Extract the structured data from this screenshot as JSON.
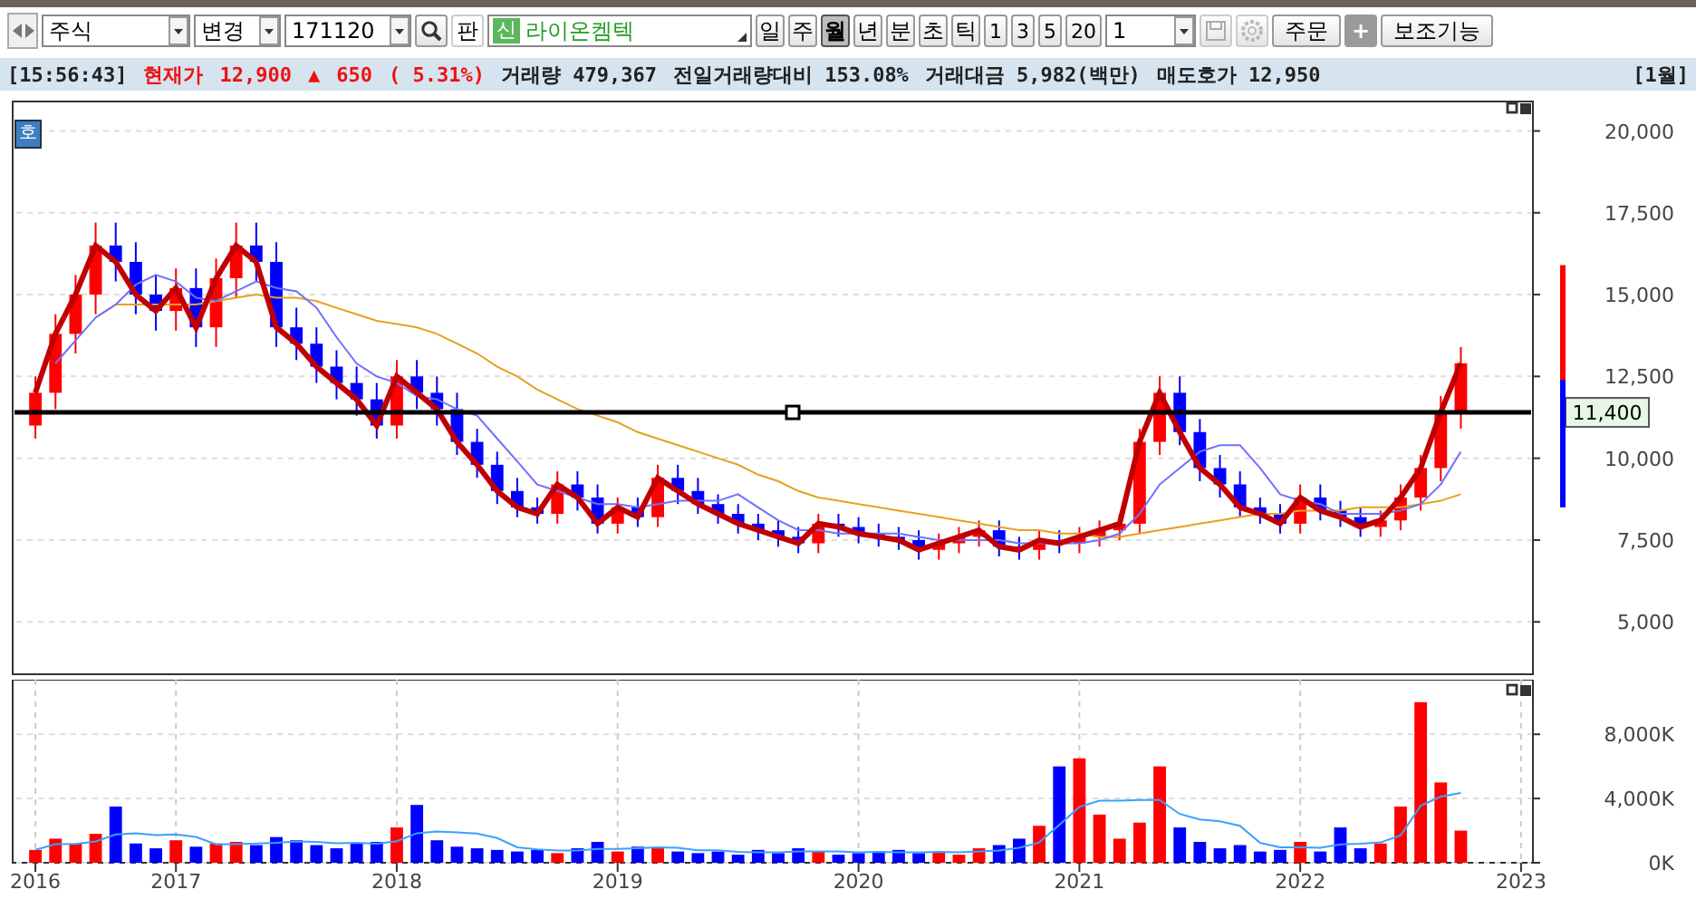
{
  "toolbar": {
    "market": "주식",
    "change": "변경",
    "code": "171120",
    "board_button": "판",
    "new_badge": "신",
    "stock_name": "라이온켐텍",
    "periods": [
      {
        "label": "일",
        "selected": false
      },
      {
        "label": "주",
        "selected": false
      },
      {
        "label": "월",
        "selected": true
      },
      {
        "label": "년",
        "selected": false
      },
      {
        "label": "분",
        "selected": false
      },
      {
        "label": "초",
        "selected": false
      },
      {
        "label": "틱",
        "selected": false
      }
    ],
    "intervals": [
      "1",
      "3",
      "5",
      "20"
    ],
    "count": "1",
    "order_button": "주문",
    "plus_button": "+",
    "aux_button": "보조기능"
  },
  "status_bar": [
    {
      "text": "[15:56:43]",
      "color": "#222222"
    },
    {
      "text": "현재가",
      "color": "#ee1111"
    },
    {
      "text": "12,900",
      "color": "#ee1111"
    },
    {
      "text": "▲",
      "color": "#ee1111"
    },
    {
      "text": "650",
      "color": "#ee1111"
    },
    {
      "text": "( 5.31%)",
      "color": "#ee1111"
    },
    {
      "text": "거래량 479,367",
      "color": "#222222"
    },
    {
      "text": "전일거래량대비 153.08%",
      "color": "#222222"
    },
    {
      "text": "거래대금 5,982(백만)",
      "color": "#222222"
    },
    {
      "text": "매도호가 12,950",
      "color": "#222222"
    },
    {
      "text": "[1월]",
      "color": "#222222"
    }
  ],
  "price_panel": {
    "badge": "호",
    "chart_data": {
      "type": "candlestick",
      "grid": true,
      "ylim": [
        3400,
        20900
      ],
      "ohlc": [
        [
          11000,
          12500,
          10600,
          12000
        ],
        [
          12000,
          14400,
          11500,
          13800
        ],
        [
          13800,
          15600,
          13200,
          15000
        ],
        [
          15000,
          17200,
          14400,
          16500
        ],
        [
          16500,
          17200,
          15400,
          16000
        ],
        [
          16000,
          16600,
          14400,
          15000
        ],
        [
          15000,
          15600,
          13900,
          14500
        ],
        [
          14500,
          15800,
          13900,
          15200
        ],
        [
          15200,
          15800,
          13400,
          14000
        ],
        [
          14000,
          16100,
          13400,
          15500
        ],
        [
          15500,
          17200,
          14900,
          16500
        ],
        [
          16500,
          17200,
          15400,
          16000
        ],
        [
          16000,
          16600,
          13400,
          14000
        ],
        [
          14000,
          14600,
          13000,
          13500
        ],
        [
          13500,
          14000,
          12300,
          12800
        ],
        [
          12800,
          13300,
          11800,
          12300
        ],
        [
          12300,
          12800,
          11300,
          11800
        ],
        [
          11800,
          12300,
          10600,
          11000
        ],
        [
          11000,
          13000,
          10600,
          12500
        ],
        [
          12500,
          13000,
          11500,
          12000
        ],
        [
          12000,
          12500,
          11000,
          11500
        ],
        [
          11500,
          12000,
          10100,
          10500
        ],
        [
          10500,
          10900,
          9400,
          9800
        ],
        [
          9800,
          10200,
          8600,
          9000
        ],
        [
          9000,
          9400,
          8200,
          8500
        ],
        [
          8500,
          8800,
          8000,
          8300
        ],
        [
          8300,
          9600,
          8000,
          9200
        ],
        [
          9200,
          9600,
          8400,
          8800
        ],
        [
          8800,
          9200,
          7700,
          8000
        ],
        [
          8000,
          8800,
          7700,
          8500
        ],
        [
          8500,
          8800,
          7900,
          8200
        ],
        [
          8200,
          9800,
          7900,
          9400
        ],
        [
          9400,
          9800,
          8600,
          9000
        ],
        [
          9000,
          9400,
          8300,
          8600
        ],
        [
          8600,
          8900,
          8000,
          8300
        ],
        [
          8300,
          8600,
          7700,
          8000
        ],
        [
          8000,
          8300,
          7500,
          7800
        ],
        [
          7800,
          8100,
          7300,
          7600
        ],
        [
          7600,
          7900,
          7100,
          7400
        ],
        [
          7400,
          8300,
          7100,
          8000
        ],
        [
          8000,
          8300,
          7600,
          7900
        ],
        [
          7900,
          8200,
          7400,
          7700
        ],
        [
          7700,
          8000,
          7300,
          7600
        ],
        [
          7600,
          7900,
          7200,
          7500
        ],
        [
          7500,
          7800,
          6900,
          7200
        ],
        [
          7200,
          7700,
          6900,
          7400
        ],
        [
          7400,
          7900,
          7100,
          7600
        ],
        [
          7600,
          8100,
          7300,
          7800
        ],
        [
          7800,
          8100,
          7000,
          7300
        ],
        [
          7300,
          7600,
          6900,
          7200
        ],
        [
          7200,
          7800,
          6900,
          7500
        ],
        [
          7500,
          7800,
          7100,
          7400
        ],
        [
          7400,
          7900,
          7100,
          7600
        ],
        [
          7600,
          8100,
          7300,
          7800
        ],
        [
          7800,
          8300,
          7500,
          8000
        ],
        [
          8000,
          10900,
          7700,
          10500
        ],
        [
          10500,
          12500,
          10100,
          12000
        ],
        [
          12000,
          12500,
          10400,
          10800
        ],
        [
          10800,
          11200,
          9300,
          9700
        ],
        [
          9700,
          10100,
          8800,
          9200
        ],
        [
          9200,
          9600,
          8200,
          8500
        ],
        [
          8500,
          8800,
          8000,
          8300
        ],
        [
          8300,
          8600,
          7700,
          8000
        ],
        [
          8000,
          9200,
          7700,
          8800
        ],
        [
          8800,
          9200,
          8100,
          8400
        ],
        [
          8400,
          8700,
          7900,
          8200
        ],
        [
          8200,
          8500,
          7600,
          7900
        ],
        [
          7900,
          8400,
          7600,
          8100
        ],
        [
          8100,
          9200,
          7800,
          8800
        ],
        [
          8800,
          10100,
          8400,
          9700
        ],
        [
          9700,
          11900,
          9300,
          11400
        ],
        [
          11400,
          13400,
          10900,
          12900
        ],
        null,
        null,
        null
      ],
      "categories": [
        null,
        null,
        null,
        null,
        null,
        null,
        null,
        null,
        null,
        null,
        null,
        null,
        null,
        null,
        null,
        null,
        null,
        null,
        null,
        null,
        null,
        null,
        null,
        null,
        null,
        null,
        null,
        null,
        null,
        null,
        null,
        null,
        null,
        null,
        null,
        null,
        null,
        null,
        null,
        null,
        null,
        null,
        null,
        null,
        null,
        null,
        null,
        null,
        null,
        null,
        null,
        null,
        null,
        null,
        null,
        null,
        null,
        null,
        null,
        null,
        null,
        null,
        null,
        null,
        null,
        null,
        null,
        null,
        null,
        null,
        null,
        null,
        null,
        null,
        null
      ],
      "yticks": [
        {
          "value": 5000,
          "label": "5,000"
        },
        {
          "value": 7500,
          "label": "7,500"
        },
        {
          "value": 10000,
          "label": "10,000"
        },
        {
          "value": 12500,
          "label": "12,500"
        },
        {
          "value": 15000,
          "label": "15,000"
        },
        {
          "value": 17500,
          "label": "17,500"
        },
        {
          "value": 20000,
          "label": "20,000"
        }
      ],
      "ref_lines": [
        {
          "axis": "y",
          "value": 11400,
          "label": "11,400"
        }
      ],
      "series": [
        {
          "type": "line",
          "color": "#c00000",
          "values": [
            12000,
            13800,
            15000,
            16500,
            16000,
            15000,
            14500,
            15200,
            14000,
            15500,
            16500,
            16000,
            14000,
            13500,
            12800,
            12300,
            11800,
            11000,
            12500,
            12000,
            11500,
            10500,
            9800,
            9000,
            8500,
            8300,
            9200,
            8800,
            8000,
            8500,
            8200,
            9400,
            9000,
            8600,
            8300,
            8000,
            7800,
            7600,
            7400,
            8000,
            7900,
            7700,
            7600,
            7500,
            7200,
            7400,
            7600,
            7800,
            7300,
            7200,
            7500,
            7400,
            7600,
            7800,
            8000,
            10500,
            12000,
            10800,
            9700,
            9200,
            8500,
            8300,
            8000,
            8800,
            8400,
            8200,
            7900,
            8100,
            8800,
            9700,
            11400,
            12900,
            null,
            null,
            null
          ]
        },
        {
          "type": "line",
          "color": "#7070ff",
          "values": [
            null,
            12900,
            13600,
            14300,
            14700,
            15300,
            15600,
            15400,
            14900,
            14800,
            15100,
            15400,
            15200,
            15100,
            14600,
            13700,
            12900,
            12500,
            12300,
            11900,
            11800,
            11500,
            11300,
            10600,
            9900,
            9200,
            9000,
            8800,
            8600,
            8600,
            8500,
            8600,
            8700,
            8700,
            8700,
            8900,
            8500,
            8100,
            7800,
            7800,
            7700,
            7700,
            7700,
            7700,
            7600,
            7500,
            7500,
            7500,
            7500,
            7400,
            7400,
            7400,
            7400,
            7500,
            7700,
            8300,
            9200,
            9700,
            10200,
            10400,
            10400,
            9700,
            8900,
            8700,
            8600,
            8300,
            8300,
            8300,
            8400,
            8600,
            9200,
            10200,
            null,
            null,
            null
          ]
        },
        {
          "type": "line",
          "color": "#e8a020",
          "values": [
            null,
            null,
            null,
            14300,
            14700,
            14700,
            14700,
            14700,
            14700,
            14800,
            14900,
            15000,
            14900,
            14900,
            14800,
            14600,
            14400,
            14200,
            14100,
            14000,
            13800,
            13500,
            13200,
            12800,
            12500,
            12100,
            11800,
            11500,
            11300,
            11100,
            10800,
            10600,
            10400,
            10200,
            10000,
            9800,
            9500,
            9300,
            9000,
            8800,
            8700,
            8600,
            8500,
            8400,
            8300,
            8200,
            8100,
            8000,
            7900,
            7800,
            7800,
            7700,
            7700,
            7600,
            7600,
            7700,
            7800,
            7900,
            8000,
            8100,
            8200,
            8300,
            8300,
            8400,
            8400,
            8400,
            8500,
            8500,
            8500,
            8600,
            8700,
            8900,
            null,
            null,
            null
          ]
        }
      ]
    }
  },
  "volume_panel": {
    "chart_data": {
      "type": "bar",
      "grid": true,
      "stacked": true,
      "ylim": [
        0,
        11400
      ],
      "categories": [
        "2016",
        null,
        null,
        null,
        null,
        null,
        null,
        "2017",
        null,
        null,
        null,
        null,
        null,
        null,
        null,
        null,
        null,
        null,
        "2018",
        null,
        null,
        null,
        null,
        null,
        null,
        null,
        null,
        null,
        null,
        "2019",
        null,
        null,
        null,
        null,
        null,
        null,
        null,
        null,
        null,
        null,
        null,
        "2020",
        null,
        null,
        null,
        null,
        null,
        null,
        null,
        null,
        null,
        null,
        "2021",
        null,
        null,
        null,
        null,
        null,
        null,
        null,
        null,
        null,
        null,
        "2022",
        null,
        null,
        null,
        null,
        null,
        null,
        null,
        null,
        null,
        null,
        "2023"
      ],
      "yticks": [
        {
          "value": 0,
          "label": "0K"
        },
        {
          "value": 4000,
          "label": "4,000K"
        },
        {
          "value": 8000,
          "label": "8,000K"
        }
      ],
      "series": [
        {
          "color": "#ff0000",
          "values": [
            800,
            1500,
            1200,
            1800,
            null,
            null,
            null,
            1400,
            null,
            1200,
            1300,
            null,
            null,
            null,
            null,
            null,
            null,
            null,
            2200,
            null,
            null,
            null,
            null,
            null,
            null,
            null,
            600,
            null,
            null,
            700,
            null,
            900,
            null,
            null,
            null,
            null,
            null,
            null,
            null,
            700,
            null,
            null,
            null,
            null,
            null,
            700,
            500,
            900,
            null,
            null,
            2300,
            null,
            6500,
            3000,
            1500,
            2500,
            6000,
            null,
            null,
            null,
            null,
            null,
            null,
            1300,
            null,
            null,
            null,
            1200,
            3500,
            10000,
            5000,
            2000,
            null,
            null,
            null
          ]
        },
        {
          "color": "#0000ff",
          "values": [
            null,
            null,
            null,
            null,
            3500,
            1200,
            900,
            null,
            1000,
            null,
            null,
            1100,
            1600,
            1400,
            1100,
            900,
            1200,
            1300,
            null,
            3600,
            1400,
            1000,
            900,
            800,
            700,
            800,
            null,
            900,
            1300,
            null,
            1000,
            null,
            700,
            600,
            700,
            500,
            800,
            600,
            900,
            null,
            500,
            600,
            700,
            800,
            600,
            null,
            null,
            null,
            1100,
            1500,
            null,
            6000,
            null,
            null,
            null,
            null,
            null,
            2200,
            1300,
            900,
            1100,
            700,
            800,
            null,
            700,
            2200,
            900,
            null,
            null,
            null,
            null,
            null,
            null,
            null,
            null
          ]
        },
        {
          "type": "line",
          "color": "#3aa0ff",
          "values": [
            800,
            1150,
            1170,
            1330,
            1760,
            1840,
            1720,
            1760,
            1600,
            1140,
            1160,
            1200,
            1240,
            1320,
            1300,
            1220,
            1240,
            1180,
            1340,
            1840,
            1940,
            1900,
            1820,
            1540,
            960,
            840,
            760,
            760,
            860,
            860,
            900,
            960,
            920,
            780,
            780,
            680,
            660,
            640,
            700,
            700,
            700,
            660,
            680,
            660,
            640,
            680,
            660,
            700,
            760,
            940,
            1260,
            2360,
            3480,
            3860,
            3860,
            3900,
            3900,
            3040,
            2700,
            2580,
            2300,
            1240,
            960,
            960,
            920,
            1140,
            1180,
            1260,
            1700,
            3560,
            4120,
            4340,
            null,
            null,
            null
          ]
        }
      ]
    }
  }
}
